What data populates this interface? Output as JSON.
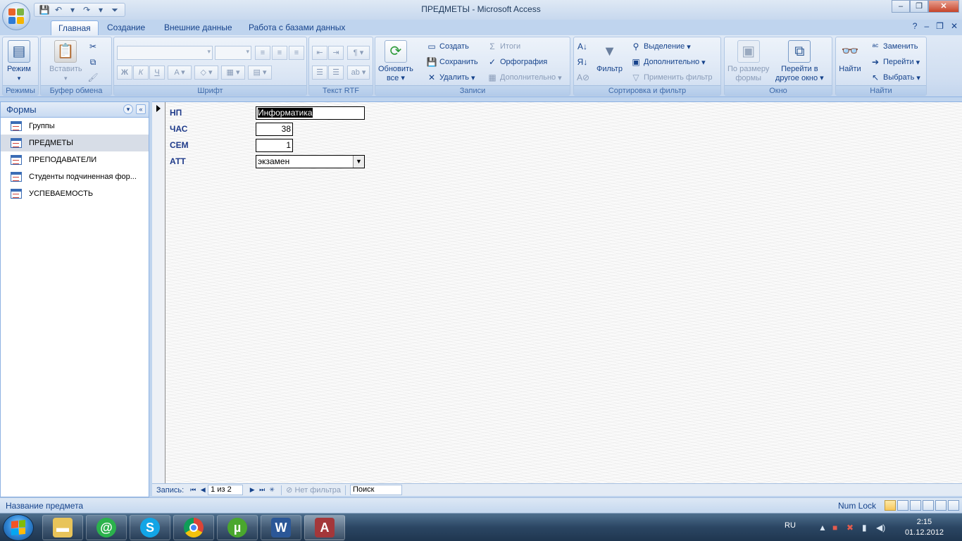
{
  "window": {
    "title": "ПРЕДМЕТЫ - Microsoft Access"
  },
  "ribbon": {
    "tabs": [
      "Главная",
      "Создание",
      "Внешние данные",
      "Работа с базами данных"
    ],
    "active_tab": "Главная",
    "groups": {
      "views": {
        "label": "Режимы",
        "mode_button": "Режим"
      },
      "clipboard": {
        "label": "Буфер обмена",
        "paste_button": "Вставить"
      },
      "font": {
        "label": "Шрифт",
        "bold": "Ж",
        "italic": "К",
        "underline": "Ч"
      },
      "rich_text": {
        "label": "Текст RTF"
      },
      "records": {
        "label": "Записи",
        "refresh_button": "Обновить все",
        "refresh_line1": "Обновить",
        "refresh_line2": "все",
        "create": "Создать",
        "save": "Сохранить",
        "delete": "Удалить",
        "totals": "Итоги",
        "spelling": "Орфография",
        "more": "Дополнительно"
      },
      "sort_filter": {
        "label": "Сортировка и фильтр",
        "filter_button": "Фильтр",
        "selection": "Выделение",
        "advanced": "Дополнительно",
        "apply_filter": "Применить фильтр"
      },
      "window": {
        "label": "Окно",
        "fit_form_line1": "По размеру",
        "fit_form_line2": "формы",
        "switch_line1": "Перейти в",
        "switch_line2": "другое окно"
      },
      "find": {
        "label": "Найти",
        "find_button": "Найти",
        "replace": "Заменить",
        "goto": "Перейти",
        "select": "Выбрать"
      }
    }
  },
  "nav_pane": {
    "title": "Формы",
    "items": [
      {
        "label": "Группы"
      },
      {
        "label": "ПРЕДМЕТЫ",
        "selected": true
      },
      {
        "label": "ПРЕПОДАВАТЕЛИ"
      },
      {
        "label": "Студенты подчиненная фор..."
      },
      {
        "label": "УСПЕВАЕМОСТЬ"
      }
    ]
  },
  "form": {
    "fields": [
      {
        "label": "НП",
        "value": "Информатика"
      },
      {
        "label": "ЧАС",
        "value": "38"
      },
      {
        "label": "СЕМ",
        "value": "1"
      },
      {
        "label": "АТТ",
        "value": "экзамен"
      }
    ]
  },
  "record_nav": {
    "label": "Запись:",
    "position": "1 из 2",
    "filter_status": "Нет фильтра",
    "search_placeholder": "Поиск"
  },
  "status_bar": {
    "text": "Название предмета",
    "num_lock": "Num Lock"
  },
  "taskbar": {
    "language": "RU",
    "time": "2:15",
    "date": "01.12.2012"
  }
}
